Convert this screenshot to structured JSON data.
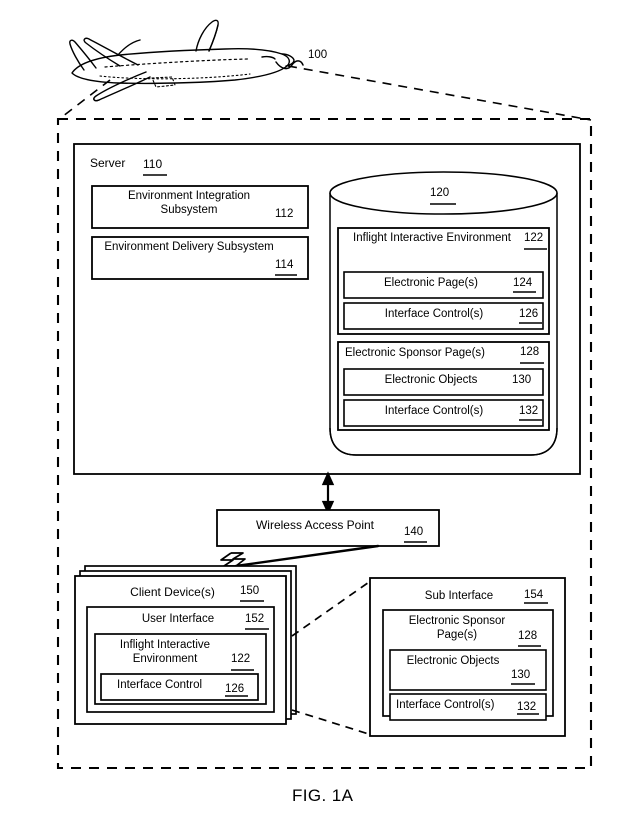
{
  "figure": {
    "caption": "FIG. 1A",
    "aircraft_ref": "100"
  },
  "aircraft": {
    "name": "airplane-illustration",
    "ref": "100"
  },
  "environment_boundary": {
    "name": "aircraft-environment-dashed-boundary",
    "style": "dashed"
  },
  "server": {
    "title": "Server",
    "ref": "110",
    "subsystems": [
      {
        "label": "Environment Integration Subsystem",
        "ref": "112"
      },
      {
        "label": "Environment Delivery Subsystem",
        "ref": "114"
      }
    ]
  },
  "datastore": {
    "ref": "120",
    "shape": "cylinder",
    "inflight_environment": {
      "label": "Inflight Interactive Environment",
      "ref": "122",
      "children": [
        {
          "label": "Electronic Page(s)",
          "ref": "124"
        },
        {
          "label": "Interface Control(s)",
          "ref": "126"
        }
      ]
    },
    "sponsor_pages": {
      "label": "Electronic Sponsor Page(s)",
      "ref": "128",
      "children": [
        {
          "label": "Electronic Objects",
          "ref": "130"
        },
        {
          "label": "Interface Control(s)",
          "ref": "132"
        }
      ]
    }
  },
  "wireless_access_point": {
    "label": "Wireless Access Point",
    "ref": "140"
  },
  "client_device": {
    "label": "Client Device(s)",
    "ref": "150",
    "user_interface": {
      "label": "User Interface",
      "ref": "152",
      "inflight_environment": {
        "label": "Inflight Interactive Environment",
        "ref": "122",
        "interface_control": {
          "label": "Interface Control",
          "ref": "126"
        }
      }
    }
  },
  "sub_interface": {
    "label": "Sub Interface",
    "ref": "154",
    "sponsor_pages": {
      "label": "Electronic Sponsor Page(s)",
      "ref": "128",
      "children": [
        {
          "label": "Electronic Objects",
          "ref": "130"
        },
        {
          "label": "Interface Control(s)",
          "ref": "132"
        }
      ]
    }
  },
  "connectors": {
    "server_to_wap": "double-headed-vertical-arrow",
    "wap_to_client": "wireless-lightning-link",
    "client_to_subinterface": "dashed-callout-lines",
    "aircraft_to_boundary": "dashed-leader-lines"
  },
  "colors": {
    "ink": "#000000",
    "paper": "#ffffff"
  }
}
